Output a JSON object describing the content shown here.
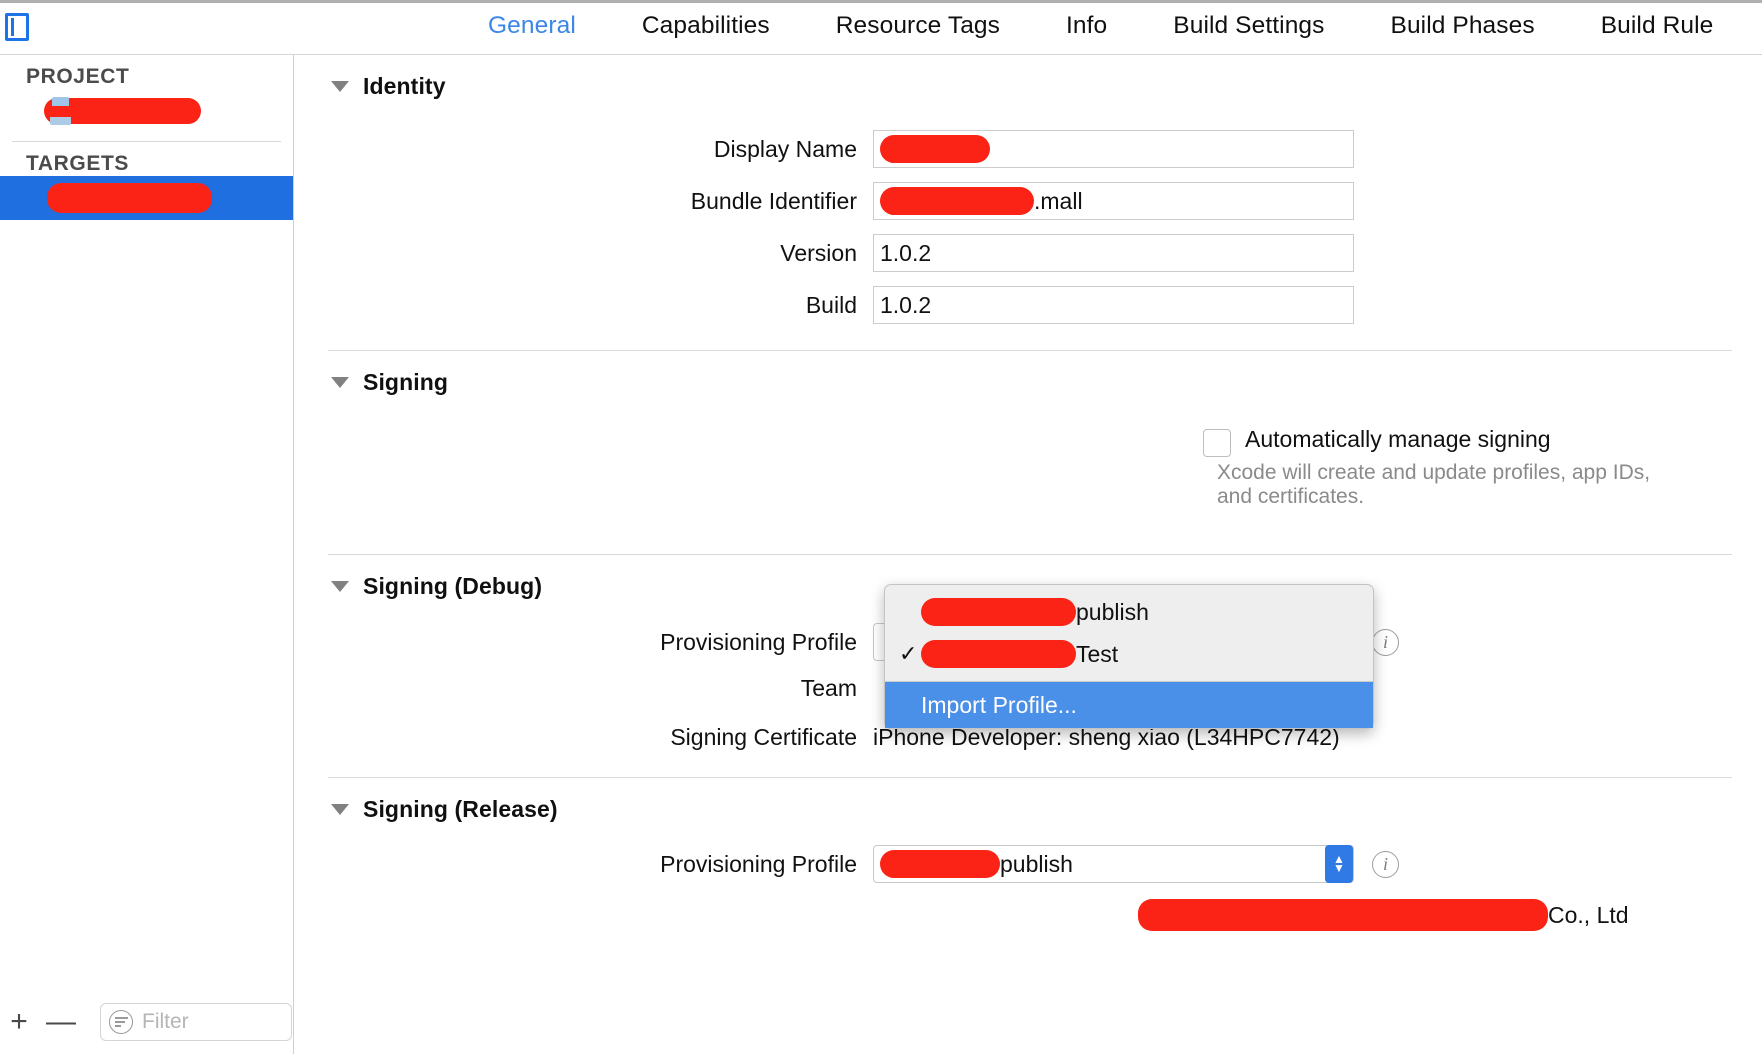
{
  "tabs": [
    {
      "label": "General",
      "active": true
    },
    {
      "label": "Capabilities",
      "active": false
    },
    {
      "label": "Resource Tags",
      "active": false
    },
    {
      "label": "Info",
      "active": false
    },
    {
      "label": "Build Settings",
      "active": false
    },
    {
      "label": "Build Phases",
      "active": false
    },
    {
      "label": "Build Rule",
      "active": false
    }
  ],
  "sidebar": {
    "project_header": "PROJECT",
    "targets_header": "TARGETS",
    "project_item_redacted": "",
    "target_item_redacted": "",
    "toolbar": {
      "add_label": "+",
      "remove_label": "—",
      "filter_placeholder": "Filter"
    }
  },
  "sections": {
    "identity": {
      "title": "Identity",
      "fields": {
        "display_name_label": "Display Name",
        "display_name_value": "",
        "bundle_identifier_label": "Bundle Identifier",
        "bundle_identifier_suffix": ".mall",
        "version_label": "Version",
        "version_value": "1.0.2",
        "build_label": "Build",
        "build_value": "1.0.2"
      }
    },
    "signing": {
      "title": "Signing",
      "auto_manage_label": "Automatically manage signing",
      "auto_manage_checked": false,
      "auto_manage_description": "Xcode will create and update profiles, app IDs, and certificates."
    },
    "signing_debug": {
      "title": "Signing (Debug)",
      "provisioning_profile_label": "Provisioning Profile",
      "team_label": "Team",
      "signing_certificate_label": "Signing Certificate",
      "signing_certificate_value": "iPhone Developer: sheng xiao (L34HPC7742)",
      "info_label": "i"
    },
    "signing_release": {
      "title": "Signing (Release)",
      "provisioning_profile_label": "Provisioning Profile",
      "provisioning_profile_suffix": "publish",
      "team_suffix": "Co., Ltd",
      "info_label": "i"
    }
  },
  "menu": {
    "items": [
      {
        "checked": false,
        "suffix": "publish",
        "redacted": true
      },
      {
        "checked": true,
        "suffix": "Test",
        "redacted": true
      },
      {
        "checked": false,
        "label": "Import Profile...",
        "highlighted": true,
        "redacted": false
      }
    ],
    "check_glyph": "✓",
    "import_label": "Import Profile..."
  },
  "colors": {
    "accent_blue": "#3b86e8",
    "selection_blue": "#1f6fe0",
    "menu_highlight": "#4a90e8",
    "redaction_red": "#fa2315"
  }
}
